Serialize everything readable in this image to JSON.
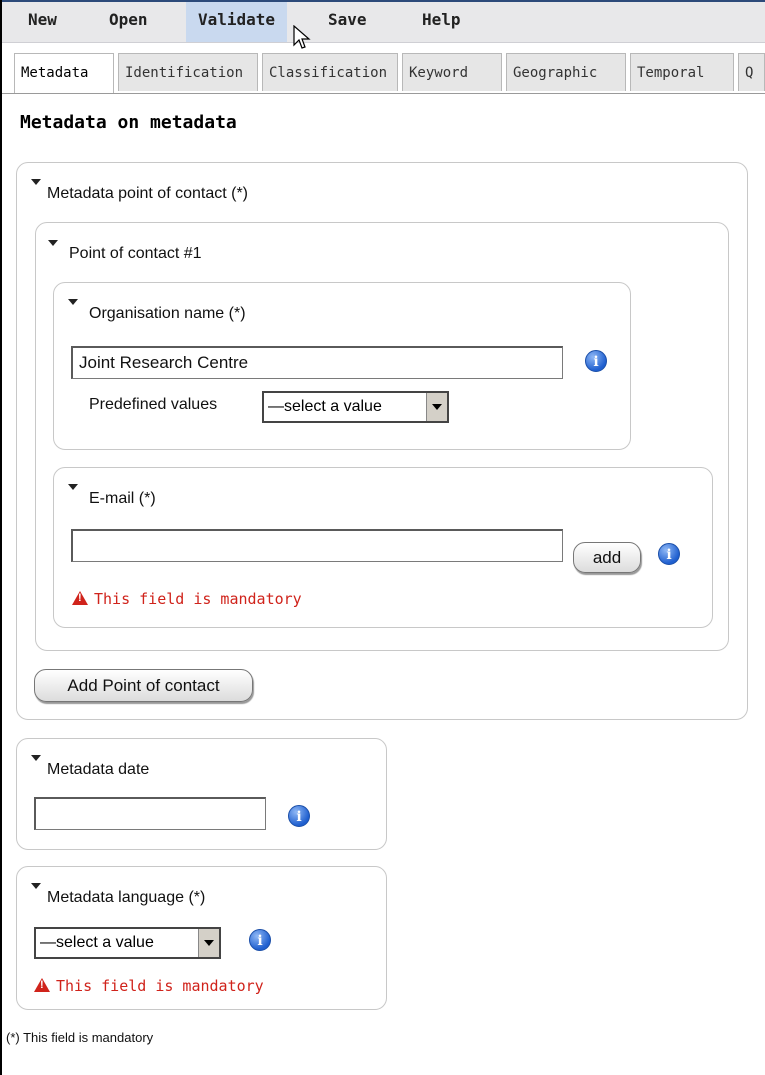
{
  "menu": [
    {
      "label": "New"
    },
    {
      "label": "Open"
    },
    {
      "label": "Validate"
    },
    {
      "label": "Save"
    },
    {
      "label": "Help"
    }
  ],
  "tabs": [
    {
      "label": "Metadata"
    },
    {
      "label": "Identification"
    },
    {
      "label": "Classification"
    },
    {
      "label": "Keyword"
    },
    {
      "label": "Geographic"
    },
    {
      "label": "Temporal"
    },
    {
      "label": "Q"
    }
  ],
  "page_title": "Metadata on metadata",
  "point_of_contact_section": {
    "title": "Metadata point of contact (*)",
    "contact": {
      "title": "Point of contact #1",
      "organisation": {
        "title": "Organisation name (*)",
        "value": "Joint Research Centre",
        "predefined_label": "Predefined values",
        "select_value": "—select a value"
      },
      "email": {
        "title": "E-mail (*)",
        "value": "",
        "add_label": "add",
        "error": "This field is mandatory"
      }
    },
    "add_contact_label": "Add Point of contact"
  },
  "metadata_date": {
    "title": "Metadata date",
    "value": ""
  },
  "metadata_language": {
    "title": "Metadata language (*)",
    "select_value": "—select a value",
    "error": "This field is mandatory"
  },
  "footnote": "(*) This field is mandatory",
  "colors": {
    "menu_active": "#c9d9ef",
    "error": "#d0231b",
    "info": "#1f5fcf"
  },
  "icons": {
    "info": "info-icon",
    "warning": "warning-icon",
    "collapse": "collapse-triangle-icon"
  }
}
